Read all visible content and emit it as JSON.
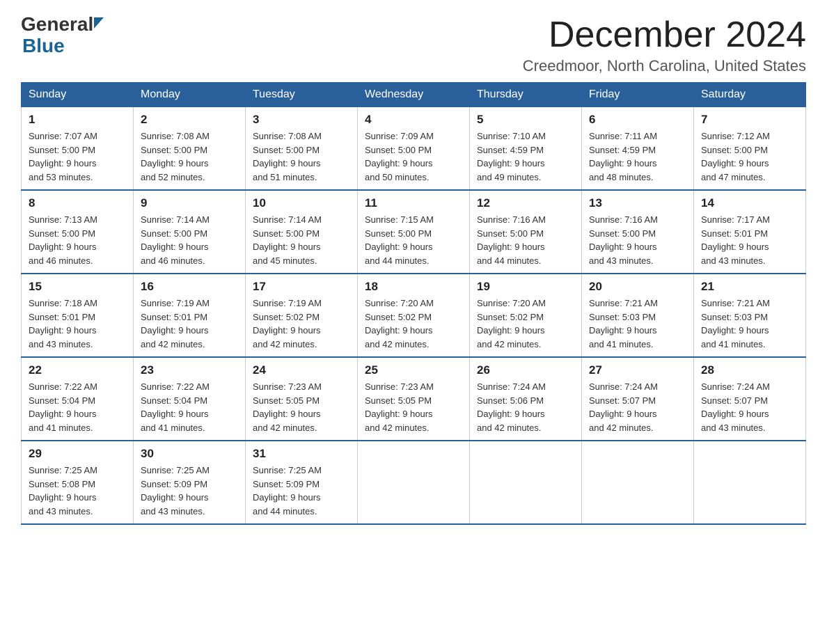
{
  "logo": {
    "general": "General",
    "blue": "Blue"
  },
  "header": {
    "month": "December 2024",
    "location": "Creedmoor, North Carolina, United States"
  },
  "days_of_week": [
    "Sunday",
    "Monday",
    "Tuesday",
    "Wednesday",
    "Thursday",
    "Friday",
    "Saturday"
  ],
  "weeks": [
    [
      {
        "day": "1",
        "sunrise": "7:07 AM",
        "sunset": "5:00 PM",
        "daylight": "9 hours and 53 minutes."
      },
      {
        "day": "2",
        "sunrise": "7:08 AM",
        "sunset": "5:00 PM",
        "daylight": "9 hours and 52 minutes."
      },
      {
        "day": "3",
        "sunrise": "7:08 AM",
        "sunset": "5:00 PM",
        "daylight": "9 hours and 51 minutes."
      },
      {
        "day": "4",
        "sunrise": "7:09 AM",
        "sunset": "5:00 PM",
        "daylight": "9 hours and 50 minutes."
      },
      {
        "day": "5",
        "sunrise": "7:10 AM",
        "sunset": "4:59 PM",
        "daylight": "9 hours and 49 minutes."
      },
      {
        "day": "6",
        "sunrise": "7:11 AM",
        "sunset": "4:59 PM",
        "daylight": "9 hours and 48 minutes."
      },
      {
        "day": "7",
        "sunrise": "7:12 AM",
        "sunset": "5:00 PM",
        "daylight": "9 hours and 47 minutes."
      }
    ],
    [
      {
        "day": "8",
        "sunrise": "7:13 AM",
        "sunset": "5:00 PM",
        "daylight": "9 hours and 46 minutes."
      },
      {
        "day": "9",
        "sunrise": "7:14 AM",
        "sunset": "5:00 PM",
        "daylight": "9 hours and 46 minutes."
      },
      {
        "day": "10",
        "sunrise": "7:14 AM",
        "sunset": "5:00 PM",
        "daylight": "9 hours and 45 minutes."
      },
      {
        "day": "11",
        "sunrise": "7:15 AM",
        "sunset": "5:00 PM",
        "daylight": "9 hours and 44 minutes."
      },
      {
        "day": "12",
        "sunrise": "7:16 AM",
        "sunset": "5:00 PM",
        "daylight": "9 hours and 44 minutes."
      },
      {
        "day": "13",
        "sunrise": "7:16 AM",
        "sunset": "5:00 PM",
        "daylight": "9 hours and 43 minutes."
      },
      {
        "day": "14",
        "sunrise": "7:17 AM",
        "sunset": "5:01 PM",
        "daylight": "9 hours and 43 minutes."
      }
    ],
    [
      {
        "day": "15",
        "sunrise": "7:18 AM",
        "sunset": "5:01 PM",
        "daylight": "9 hours and 43 minutes."
      },
      {
        "day": "16",
        "sunrise": "7:19 AM",
        "sunset": "5:01 PM",
        "daylight": "9 hours and 42 minutes."
      },
      {
        "day": "17",
        "sunrise": "7:19 AM",
        "sunset": "5:02 PM",
        "daylight": "9 hours and 42 minutes."
      },
      {
        "day": "18",
        "sunrise": "7:20 AM",
        "sunset": "5:02 PM",
        "daylight": "9 hours and 42 minutes."
      },
      {
        "day": "19",
        "sunrise": "7:20 AM",
        "sunset": "5:02 PM",
        "daylight": "9 hours and 42 minutes."
      },
      {
        "day": "20",
        "sunrise": "7:21 AM",
        "sunset": "5:03 PM",
        "daylight": "9 hours and 41 minutes."
      },
      {
        "day": "21",
        "sunrise": "7:21 AM",
        "sunset": "5:03 PM",
        "daylight": "9 hours and 41 minutes."
      }
    ],
    [
      {
        "day": "22",
        "sunrise": "7:22 AM",
        "sunset": "5:04 PM",
        "daylight": "9 hours and 41 minutes."
      },
      {
        "day": "23",
        "sunrise": "7:22 AM",
        "sunset": "5:04 PM",
        "daylight": "9 hours and 41 minutes."
      },
      {
        "day": "24",
        "sunrise": "7:23 AM",
        "sunset": "5:05 PM",
        "daylight": "9 hours and 42 minutes."
      },
      {
        "day": "25",
        "sunrise": "7:23 AM",
        "sunset": "5:05 PM",
        "daylight": "9 hours and 42 minutes."
      },
      {
        "day": "26",
        "sunrise": "7:24 AM",
        "sunset": "5:06 PM",
        "daylight": "9 hours and 42 minutes."
      },
      {
        "day": "27",
        "sunrise": "7:24 AM",
        "sunset": "5:07 PM",
        "daylight": "9 hours and 42 minutes."
      },
      {
        "day": "28",
        "sunrise": "7:24 AM",
        "sunset": "5:07 PM",
        "daylight": "9 hours and 43 minutes."
      }
    ],
    [
      {
        "day": "29",
        "sunrise": "7:25 AM",
        "sunset": "5:08 PM",
        "daylight": "9 hours and 43 minutes."
      },
      {
        "day": "30",
        "sunrise": "7:25 AM",
        "sunset": "5:09 PM",
        "daylight": "9 hours and 43 minutes."
      },
      {
        "day": "31",
        "sunrise": "7:25 AM",
        "sunset": "5:09 PM",
        "daylight": "9 hours and 44 minutes."
      },
      null,
      null,
      null,
      null
    ]
  ],
  "labels": {
    "sunrise": "Sunrise:",
    "sunset": "Sunset:",
    "daylight": "Daylight:"
  }
}
